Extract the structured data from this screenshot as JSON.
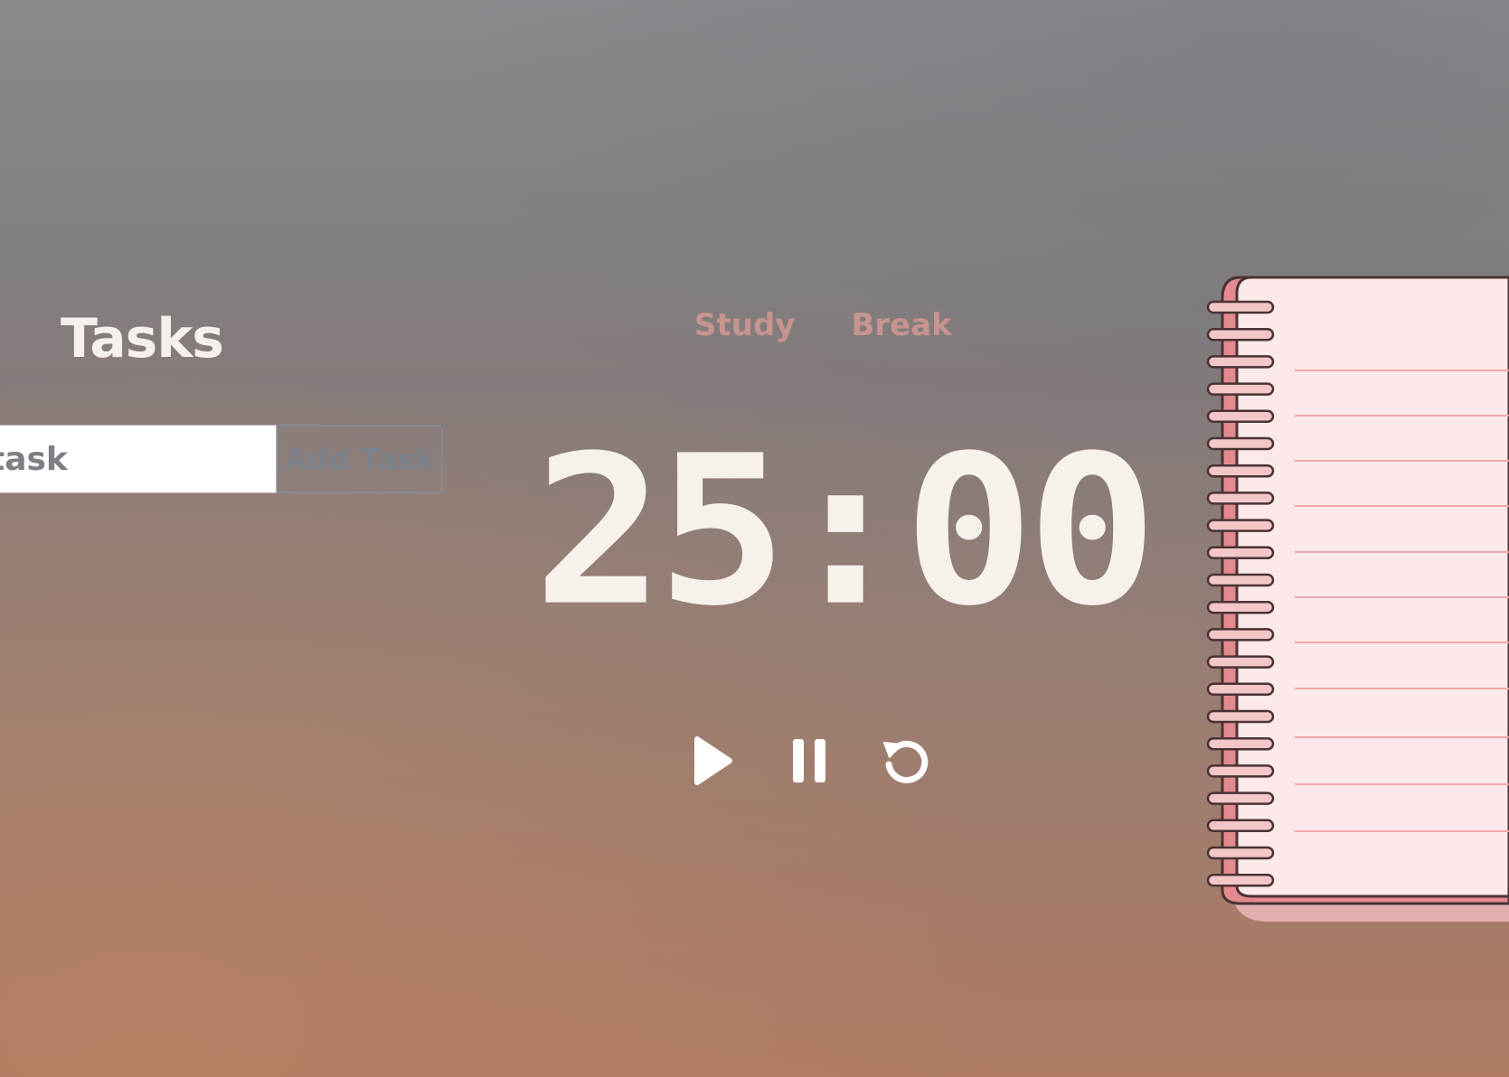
{
  "tasks": {
    "title": "Tasks",
    "input_value": "task",
    "add_button_label": "Add Task"
  },
  "modes": {
    "study_label": "Study",
    "break_label": "Break"
  },
  "timer": {
    "display": "25:00"
  },
  "controls": {
    "play_icon": "play-icon",
    "pause_icon": "pause-icon",
    "reset_icon": "reset-icon"
  },
  "colors": {
    "timer_text": "#f7f1ec",
    "mode_tab": "#c7938f",
    "notebook_page": "#fce9e9",
    "notebook_spine": "#e28a8d"
  }
}
